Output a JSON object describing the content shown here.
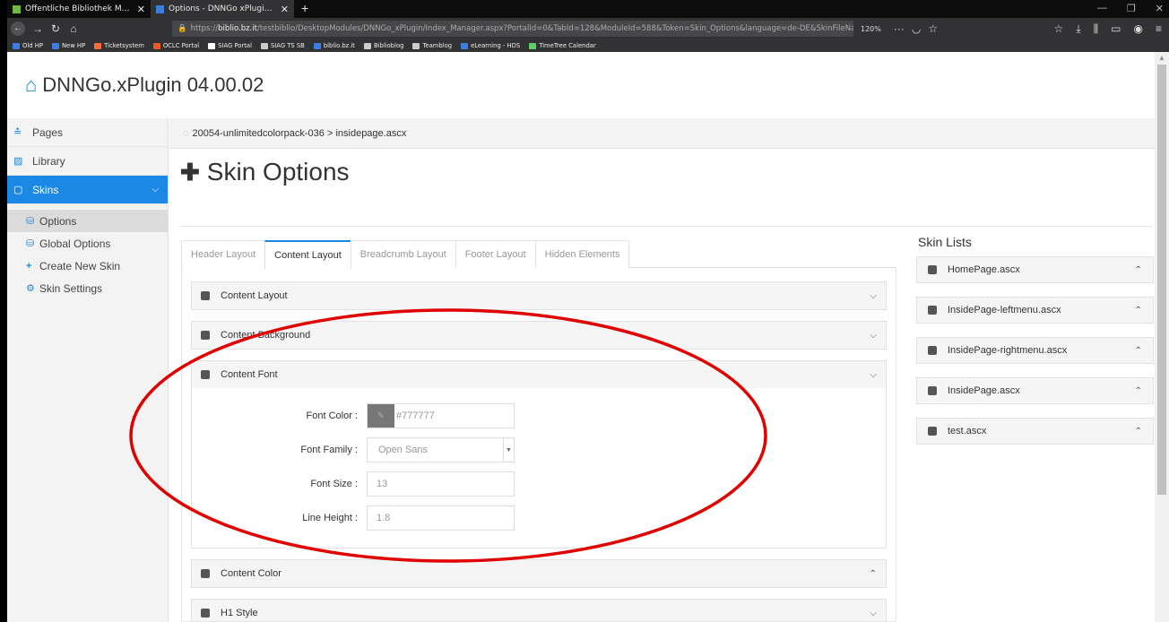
{
  "browser": {
    "tabs": [
      {
        "title": "Öffentliche Bibliothek Musterh",
        "close": "✕"
      },
      {
        "title": "Options - DNNGo xPlugin - xPl",
        "close": "✕"
      }
    ],
    "new_tab": "+",
    "url_prefix": "https://",
    "url_host": "biblio.bz.it",
    "url_rest": "/testbiblio/DesktopModules/DNNGo_xPlugin/Index_Manager.aspx?PortalId=0&TabId=128&ModuleId=588&Token=Skin_Options&language=de-DE&SkinFileName=",
    "zoom": "120%",
    "bookmarks": [
      "Old HP",
      "New HP",
      "Ticketsystem",
      "OCLC Portal",
      "SIAG Portal",
      "SIAG TS SB",
      "biblio.bz.it",
      "Biblioblog",
      "Teamblog",
      "eLearning - HDS",
      "TimeTree Calendar"
    ],
    "bookmark_colors": [
      "#3c7de0",
      "#3c7de0",
      "#ff6b3d",
      "#e85a2a",
      "#ffffff",
      "#cccccc",
      "#3c7de0",
      "#cccccc",
      "#cccccc",
      "#3c7de0",
      "#5fcf6a"
    ]
  },
  "app": {
    "title": "DNNGo.xPlugin 04.00.02",
    "accent": "#1a88e4"
  },
  "sidebar": {
    "items": [
      {
        "label": "Pages",
        "icon": "pages-icon"
      },
      {
        "label": "Library",
        "icon": "image-icon"
      },
      {
        "label": "Skins",
        "icon": "skins-icon",
        "active": true
      }
    ],
    "subitems": [
      {
        "label": "Options",
        "icon": "database-icon",
        "active": true
      },
      {
        "label": "Global Options",
        "icon": "database-icon"
      },
      {
        "label": "Create New Skin",
        "icon": "plus-icon"
      },
      {
        "label": "Skin Settings",
        "icon": "gear-icon"
      }
    ]
  },
  "breadcrumb": "20054-unlimitedcolorpack-036 > insidepage.ascx",
  "page_title": "Skin Options",
  "tabs": [
    "Header Layout",
    "Content Layout",
    "Breadcrumb Layout",
    "Footer Layout",
    "Hidden Elements"
  ],
  "active_tab": "Content Layout",
  "accordions": [
    {
      "title": "Content Layout",
      "state": "collapsed"
    },
    {
      "title": "Content Background",
      "state": "collapsed"
    },
    {
      "title": "Content Font",
      "state": "expanded"
    },
    {
      "title": "Content Color",
      "state": "collapsed-up"
    },
    {
      "title": "H1 Style",
      "state": "collapsed"
    }
  ],
  "content_font": {
    "font_color_label": "Font Color :",
    "font_color_value": "#777777",
    "font_family_label": "Font Family :",
    "font_family_value": "Open Sans",
    "font_size_label": "Font Size :",
    "font_size_value": "13",
    "line_height_label": "Line Height :",
    "line_height_value": "1.8"
  },
  "skin_lists": {
    "title": "Skin Lists",
    "items": [
      "HomePage.ascx",
      "InsidePage-leftmenu.ascx",
      "InsidePage-rightmenu.ascx",
      "InsidePage.ascx",
      "test.ascx"
    ]
  },
  "annotation_color": "#e00000"
}
